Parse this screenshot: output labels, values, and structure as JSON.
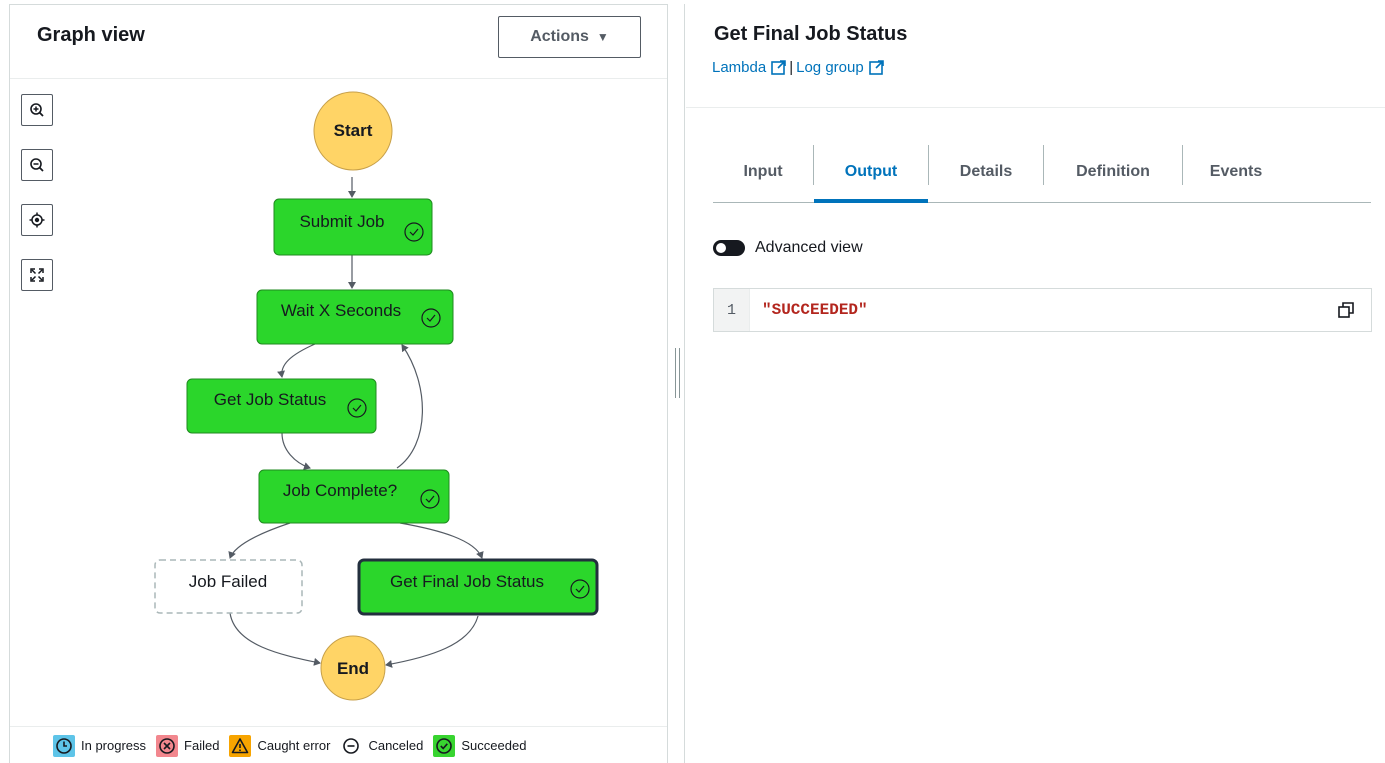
{
  "graph_panel": {
    "title": "Graph view",
    "actions_label": "Actions",
    "zoom_tools": [
      "zoom-in",
      "zoom-out",
      "center",
      "fit-to-screen"
    ],
    "nodes": {
      "start": "Start",
      "submit_job": "Submit Job",
      "wait": "Wait X Seconds",
      "get_job_status": "Get Job Status",
      "job_complete": "Job Complete?",
      "job_failed": "Job Failed",
      "get_final_job_status": "Get Final Job Status",
      "end": "End"
    },
    "node_states": {
      "submit_job": "succeeded",
      "wait": "succeeded",
      "get_job_status": "succeeded",
      "job_complete": "succeeded",
      "job_failed": "not-run",
      "get_final_job_status": "succeeded-selected"
    },
    "legend": [
      {
        "label": "In progress",
        "icon": "clock-icon",
        "color": "#5ec4e8"
      },
      {
        "label": "Failed",
        "icon": "x-circle-icon",
        "color": "#f2878e"
      },
      {
        "label": "Caught error",
        "icon": "warning-icon",
        "color": "#f7a400"
      },
      {
        "label": "Canceled",
        "icon": "minus-circle-icon",
        "color": "#d5dbdb"
      },
      {
        "label": "Succeeded",
        "icon": "check-circle-icon",
        "color": "#38d430"
      }
    ]
  },
  "detail_panel": {
    "title": "Get Final Job Status",
    "links": [
      {
        "label": "Lambda"
      },
      {
        "label": "Log group"
      }
    ],
    "link_separator": "|",
    "tabs": [
      {
        "label": "Input",
        "active": false
      },
      {
        "label": "Output",
        "active": true
      },
      {
        "label": "Details",
        "active": false
      },
      {
        "label": "Definition",
        "active": false
      },
      {
        "label": "Events",
        "active": false
      }
    ],
    "advanced_view_label": "Advanced view",
    "advanced_view_on": false,
    "code": {
      "line_number": "1",
      "value": "\"SUCCEEDED\""
    }
  },
  "colors": {
    "success_fill": "#2bd62b",
    "start_end_fill": "#ffd466",
    "link": "#0073bb",
    "string_value": "#b3261e"
  }
}
